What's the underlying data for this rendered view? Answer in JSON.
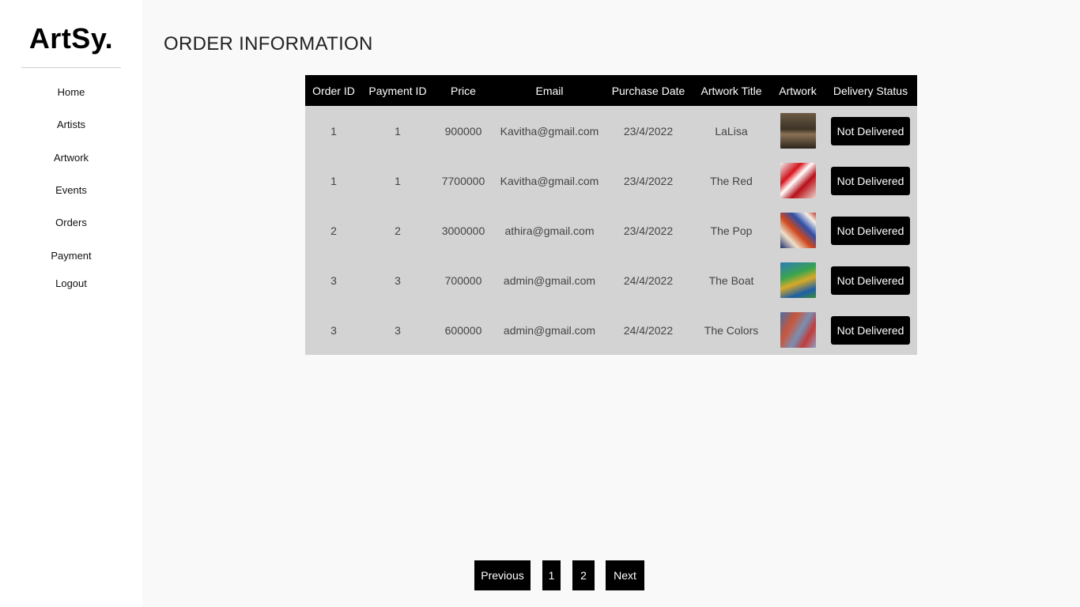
{
  "brand": {
    "logo": "ArtSy."
  },
  "nav": {
    "items": [
      {
        "label": "Home"
      },
      {
        "label": "Artists"
      },
      {
        "label": "Artwork"
      },
      {
        "label": "Events"
      },
      {
        "label": "Orders"
      },
      {
        "label": "Payment"
      },
      {
        "label": "Logout"
      }
    ]
  },
  "page": {
    "title": "ORDER INFORMATION"
  },
  "table": {
    "headers": [
      "Order ID",
      "Payment ID",
      "Price",
      "Email",
      "Purchase Date",
      "Artwork Title",
      "Artwork",
      "Delivery Status"
    ],
    "rows": [
      {
        "order_id": "1",
        "payment_id": "1",
        "price": "900000",
        "email": "Kavitha@gmail.com",
        "date": "23/4/2022",
        "title": "LaLisa",
        "artwork_icon": "portrait-painting",
        "status": "Not Delivered"
      },
      {
        "order_id": "1",
        "payment_id": "1",
        "price": "7700000",
        "email": "Kavitha@gmail.com",
        "date": "23/4/2022",
        "title": "The Red",
        "artwork_icon": "red-abstract-painting",
        "status": "Not Delivered"
      },
      {
        "order_id": "2",
        "payment_id": "2",
        "price": "3000000",
        "email": "athira@gmail.com",
        "date": "23/4/2022",
        "title": "The Pop",
        "artwork_icon": "pop-art-painting",
        "status": "Not Delivered"
      },
      {
        "order_id": "3",
        "payment_id": "3",
        "price": "700000",
        "email": "admin@gmail.com",
        "date": "24/4/2022",
        "title": "The Boat",
        "artwork_icon": "boat-landscape-painting",
        "status": "Not Delivered"
      },
      {
        "order_id": "3",
        "payment_id": "3",
        "price": "600000",
        "email": "admin@gmail.com",
        "date": "24/4/2022",
        "title": "The Colors",
        "artwork_icon": "colorful-abstract-painting",
        "status": "Not Delivered"
      }
    ]
  },
  "pagination": {
    "previous": "Previous",
    "pages": [
      "1",
      "2"
    ],
    "next": "Next"
  },
  "colors": {
    "background": "#f9f9f9",
    "sidebar": "#ffffff",
    "table_header": "#000000",
    "table_body": "#d3d3d3",
    "button": "#000000"
  }
}
